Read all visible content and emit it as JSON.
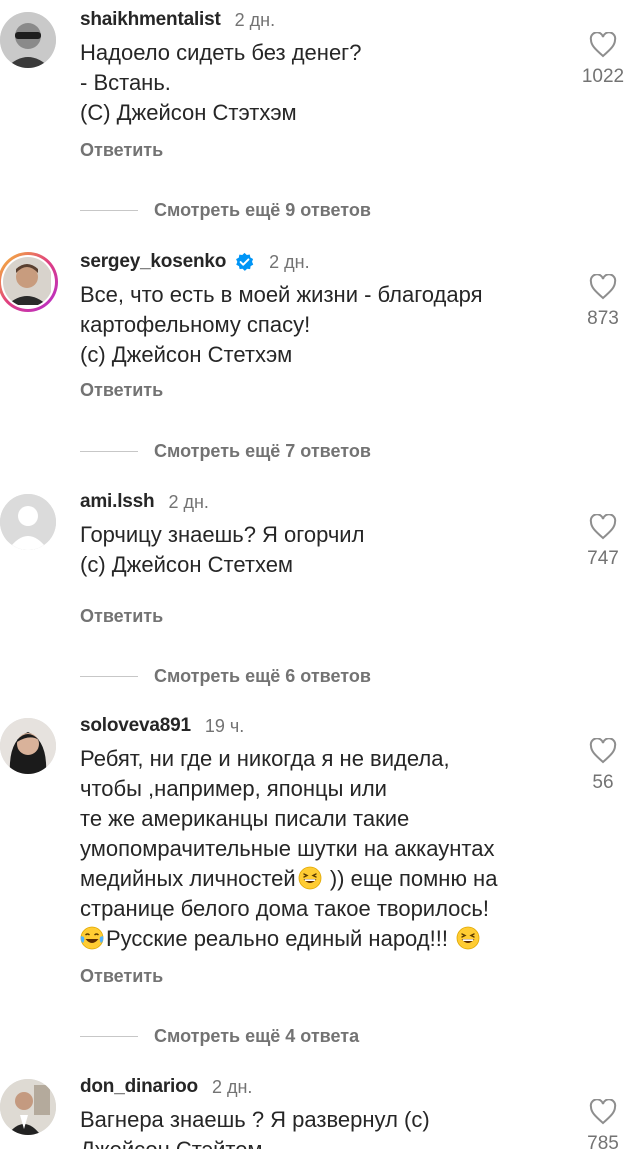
{
  "comments": [
    {
      "username": "shaikhmentalist",
      "time": "2 дн.",
      "body": "Надоело сидеть без денег?\n- Встань.\n(С) Джейсон Стэтхэм",
      "reply_label": "Ответить",
      "likes": "1022",
      "verified": false,
      "more_replies": "Смотреть ещё 9 ответов"
    },
    {
      "username": "sergey_kosenko",
      "time": "2 дн.",
      "body": "Все, что есть в моей жизни - благодаря\nкартофельному спасу!\n(с) Джейсон Стетхэм",
      "reply_label": "Ответить",
      "likes": "873",
      "verified": true,
      "more_replies": "Смотреть ещё 7 ответов"
    },
    {
      "username": "ami.lssh",
      "time": "2 дн.",
      "body": "Горчицу знаешь? Я огорчил\n(с) Джейсон Стетхем",
      "reply_label": "Ответить",
      "likes": "747",
      "verified": false,
      "more_replies": "Смотреть ещё 6 ответов"
    },
    {
      "username": "soloveva891",
      "time": "19 ч.",
      "body_line1": "Ребят,  ни где и никогда я не видела,",
      "body_line2": "чтобы ,например, японцы или",
      "body_line3": "те же американцы писали такие",
      "body_line4": "умопомрачительные шутки на аккаунтах",
      "body_line5a": "медийных личностей",
      "body_line5b": " )) еще помню на",
      "body_line6": "странице белого дома такое творилось!",
      "body_line7a": "Русские реально единый народ!!! ",
      "reply_label": "Ответить",
      "likes": "56",
      "verified": false,
      "more_replies": "Смотреть ещё 4 ответа"
    },
    {
      "username": "don_dinarioo",
      "time": "2 дн.",
      "body": "Вагнера знаешь ? Я развернул (с)\nДжейсон Стэйтем",
      "likes": "785",
      "verified": false
    }
  ],
  "icons": {
    "like": "heart-outline-icon",
    "verified": "verified-badge-icon",
    "emoji_grin": "grinning-squinting-emoji",
    "emoji_laugh_cry": "face-with-tears-of-joy-emoji"
  },
  "colors": {
    "verified": "#0095f6",
    "muted": "#737373",
    "text": "#262626"
  }
}
